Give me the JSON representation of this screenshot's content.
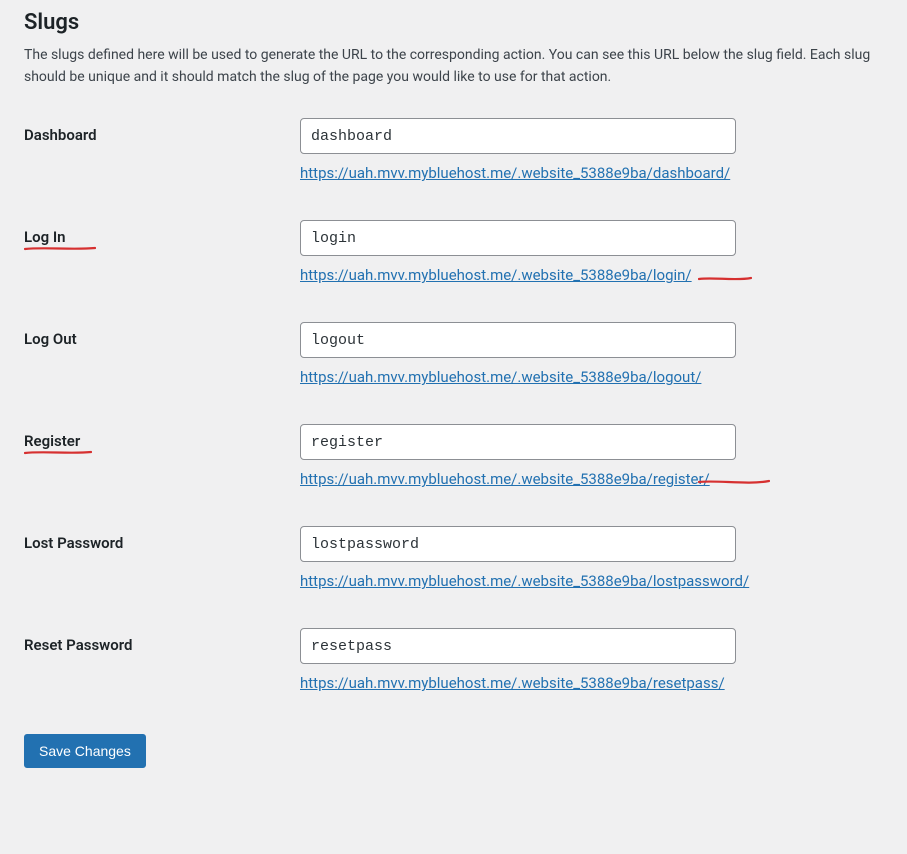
{
  "section": {
    "title": "Slugs",
    "description": "The slugs defined here will be used to generate the URL to the corresponding action. You can see this URL below the slug field. Each slug should be unique and it should match the slug of the page you would like to use for that action."
  },
  "base_url": "https://uah.mvv.mybluehost.me/.website_5388e9ba/",
  "fields": {
    "dashboard": {
      "label": "Dashboard",
      "value": "dashboard",
      "url": "https://uah.mvv.mybluehost.me/.website_5388e9ba/dashboard/"
    },
    "login": {
      "label": "Log In",
      "value": "login",
      "url": "https://uah.mvv.mybluehost.me/.website_5388e9ba/login/"
    },
    "logout": {
      "label": "Log Out",
      "value": "logout",
      "url": "https://uah.mvv.mybluehost.me/.website_5388e9ba/logout/"
    },
    "register": {
      "label": "Register",
      "value": "register",
      "url": "https://uah.mvv.mybluehost.me/.website_5388e9ba/register/"
    },
    "lostpassword": {
      "label": "Lost Password",
      "value": "lostpassword",
      "url": "https://uah.mvv.mybluehost.me/.website_5388e9ba/lostpassword/"
    },
    "resetpass": {
      "label": "Reset Password",
      "value": "resetpass",
      "url": "https://uah.mvv.mybluehost.me/.website_5388e9ba/resetpass/"
    }
  },
  "actions": {
    "save_label": "Save Changes"
  }
}
